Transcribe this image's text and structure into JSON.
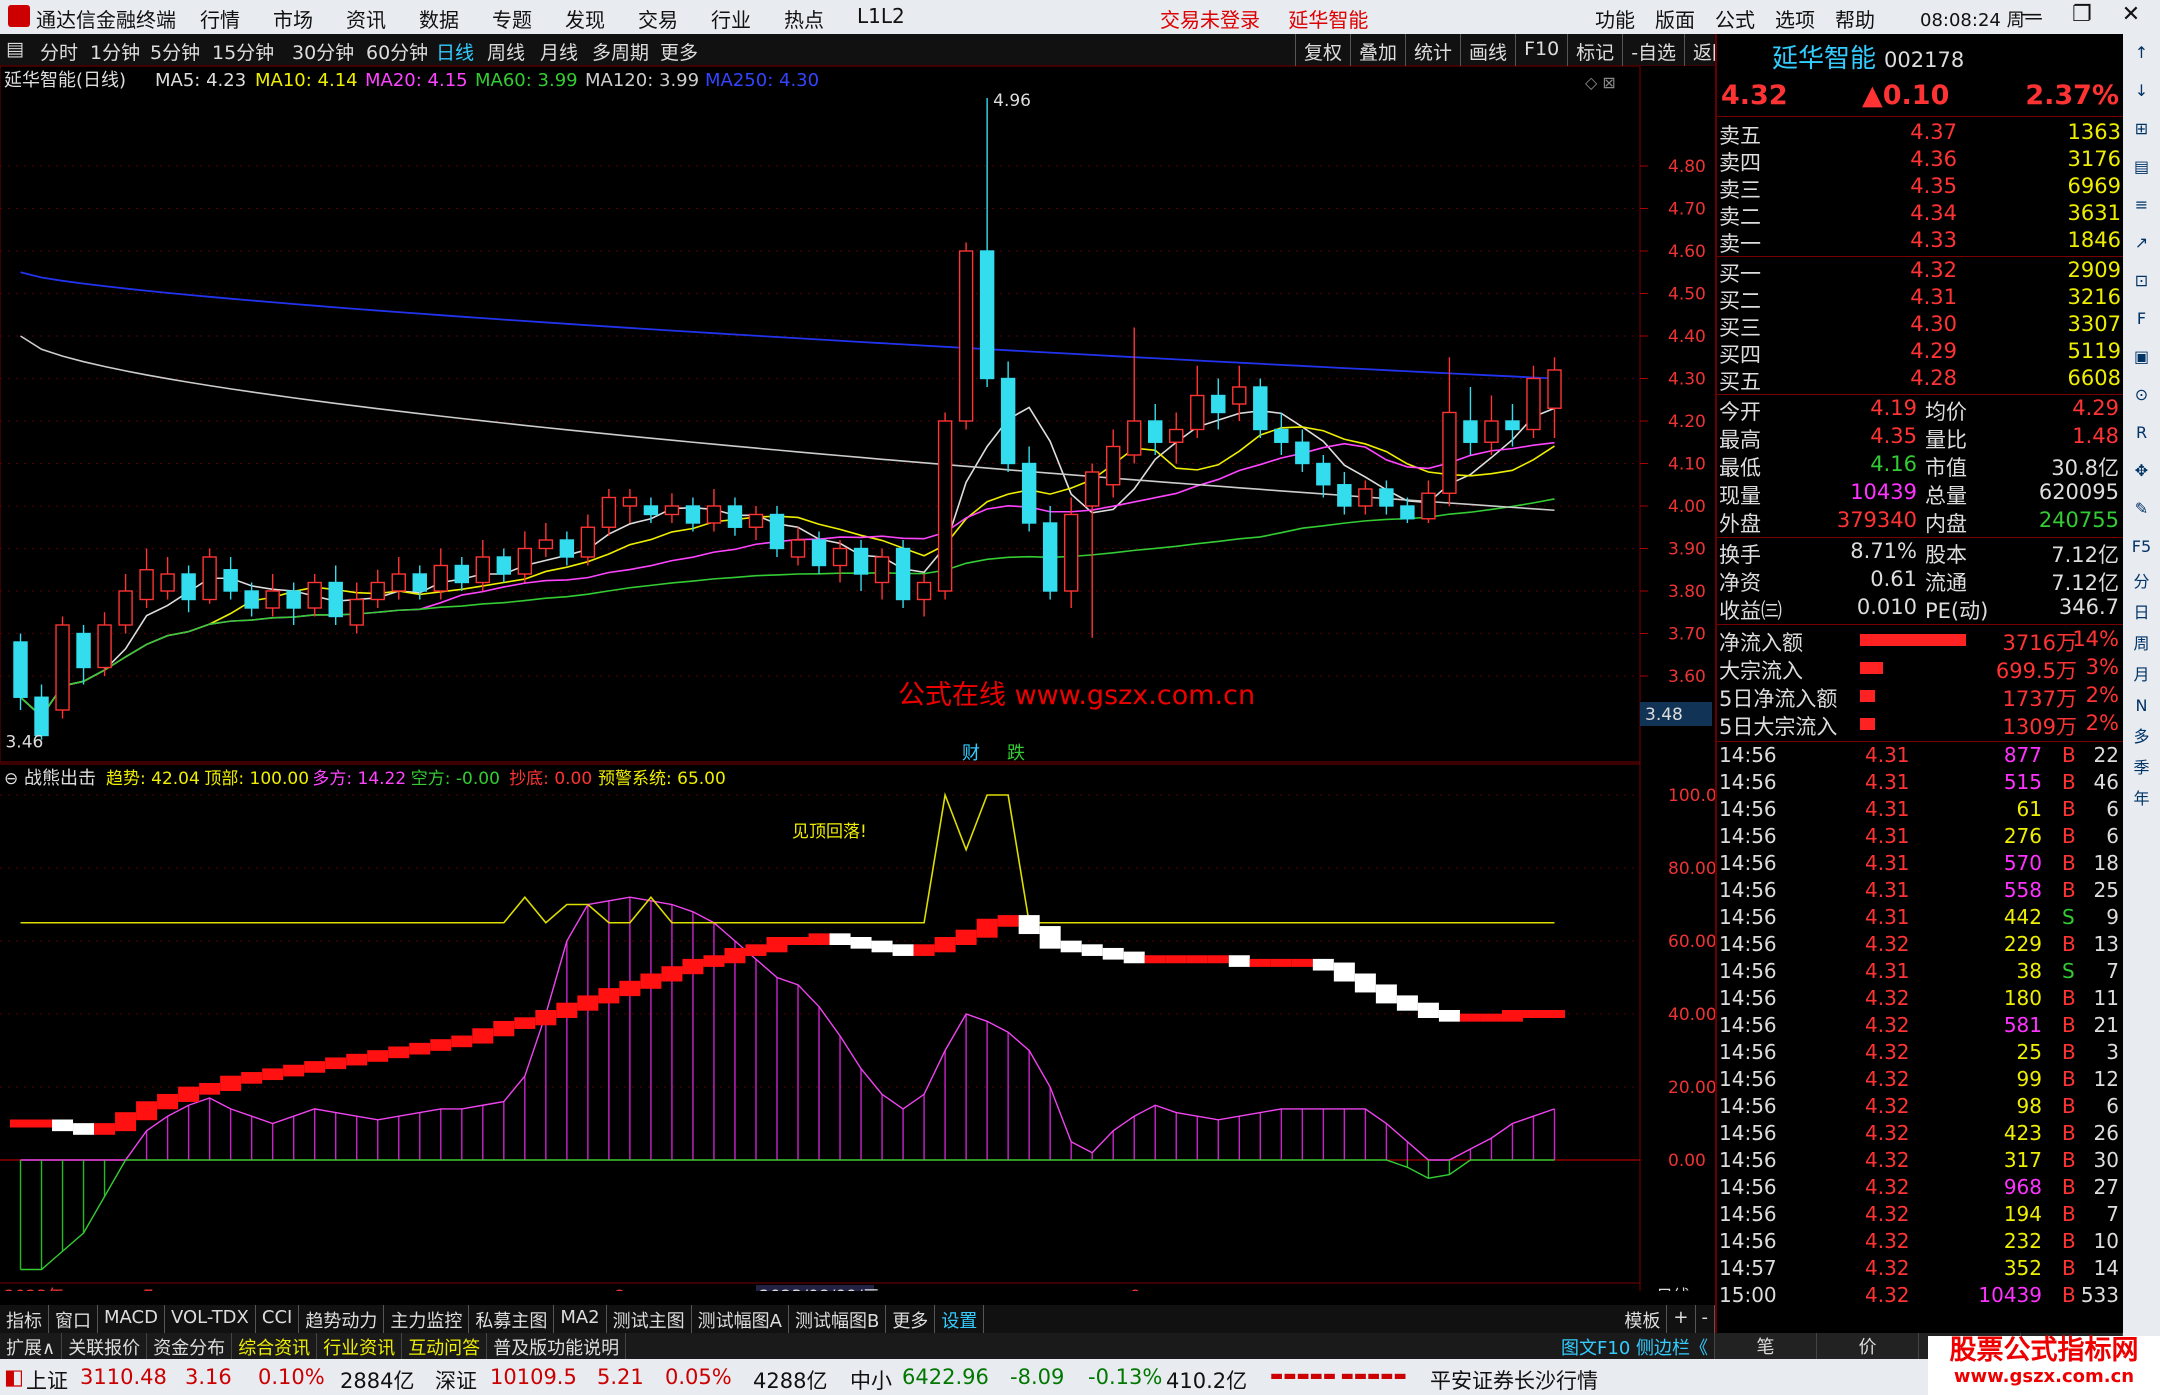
{
  "titlebar": {
    "app": "通达信金融终端",
    "menus": [
      "行情",
      "市场",
      "资讯",
      "数据",
      "专题",
      "发现",
      "交易",
      "行业",
      "热点",
      "L1L2"
    ],
    "trade_status": "交易未登录",
    "stock_name": "延华智能",
    "funcs": [
      "功能",
      "版面",
      "公式",
      "选项",
      "帮助"
    ],
    "time": "08:08:24",
    "weekday": "周一"
  },
  "periods": [
    "分时",
    "1分钟",
    "5分钟",
    "15分钟",
    "30分钟",
    "60分钟",
    "日线",
    "周线",
    "月线",
    "多周期",
    "更多"
  ],
  "active_period": "日线",
  "tools": [
    "复权",
    "叠加",
    "统计",
    "画线",
    "F10",
    "标记",
    "-自选",
    "返回"
  ],
  "main": {
    "title": "延华智能(日线)",
    "ma": [
      {
        "t": "MA5: 4.23",
        "c": "#dddddd"
      },
      {
        "t": "MA10: 4.14",
        "c": "#eeee00"
      },
      {
        "t": "MA20: 4.15",
        "c": "#ff44ff"
      },
      {
        "t": "MA60: 3.99",
        "c": "#33cc33"
      },
      {
        "t": "MA120: 3.99",
        "c": "#cccccc"
      },
      {
        "t": "MA250: 4.30",
        "c": "#3344ff"
      }
    ],
    "hi_label": "4.96",
    "lo_label": "3.46",
    "last_price": "3.48",
    "watermark": "公式在线  www.gszx.com.cn",
    "badges": [
      "财",
      "跌"
    ],
    "yticks": [
      "4.80",
      "4.70",
      "4.60",
      "4.50",
      "4.40",
      "4.30",
      "4.20",
      "4.10",
      "4.00",
      "3.90",
      "3.80",
      "3.70",
      "3.60"
    ]
  },
  "indicator": {
    "name": "战熊出击",
    "items": [
      {
        "t": "趋势: 42.04",
        "c": "#eeee00"
      },
      {
        "t": "顶部: 100.00",
        "c": "#eeee00"
      },
      {
        "t": "多方: 14.22",
        "c": "#ff44ff"
      },
      {
        "t": "空方: -0.00",
        "c": "#33cc33"
      },
      {
        "t": "抄底: 0.00",
        "c": "#ff3333"
      },
      {
        "t": "预警系统: 65.00",
        "c": "#eeee00"
      }
    ],
    "annotation": "见顶回落!",
    "yticks": [
      "100.0",
      "80.00",
      "60.00",
      "40.00",
      "20.00",
      "0.00"
    ]
  },
  "xaxis": {
    "labels": [
      "2023年",
      "7",
      "8",
      "9"
    ],
    "cursor": "2023/08/09/三",
    "period": "日线"
  },
  "chart_data": [
    {
      "type": "candlestick",
      "title": "延华智能(日线)",
      "ylim": [
        3.46,
        4.96
      ],
      "hi": 4.96,
      "lo": 3.46,
      "ma": {
        "MA5": 4.23,
        "MA10": 4.14,
        "MA20": 4.15,
        "MA60": 3.99,
        "MA120": 3.99,
        "MA250": 4.3
      },
      "candles": [
        [
          3.68,
          3.55,
          3.7,
          3.52
        ],
        [
          3.55,
          3.46,
          3.58,
          3.45
        ],
        [
          3.52,
          3.72,
          3.74,
          3.5
        ],
        [
          3.7,
          3.62,
          3.72,
          3.58
        ],
        [
          3.62,
          3.72,
          3.75,
          3.6
        ],
        [
          3.72,
          3.8,
          3.84,
          3.7
        ],
        [
          3.78,
          3.85,
          3.9,
          3.76
        ],
        [
          3.8,
          3.84,
          3.88,
          3.78
        ],
        [
          3.84,
          3.78,
          3.86,
          3.75
        ],
        [
          3.78,
          3.88,
          3.9,
          3.77
        ],
        [
          3.85,
          3.8,
          3.88,
          3.78
        ],
        [
          3.8,
          3.76,
          3.82,
          3.74
        ],
        [
          3.76,
          3.8,
          3.84,
          3.74
        ],
        [
          3.8,
          3.76,
          3.82,
          3.72
        ],
        [
          3.76,
          3.82,
          3.84,
          3.74
        ],
        [
          3.82,
          3.74,
          3.86,
          3.72
        ],
        [
          3.72,
          3.78,
          3.82,
          3.7
        ],
        [
          3.78,
          3.82,
          3.85,
          3.76
        ],
        [
          3.8,
          3.84,
          3.88,
          3.78
        ],
        [
          3.84,
          3.8,
          3.86,
          3.78
        ],
        [
          3.8,
          3.86,
          3.9,
          3.78
        ],
        [
          3.86,
          3.82,
          3.88,
          3.8
        ],
        [
          3.82,
          3.88,
          3.92,
          3.8
        ],
        [
          3.88,
          3.84,
          3.9,
          3.82
        ],
        [
          3.84,
          3.9,
          3.94,
          3.82
        ],
        [
          3.9,
          3.92,
          3.96,
          3.88
        ],
        [
          3.92,
          3.88,
          3.94,
          3.86
        ],
        [
          3.88,
          3.95,
          3.98,
          3.86
        ],
        [
          3.95,
          4.02,
          4.04,
          3.93
        ],
        [
          4.0,
          4.02,
          4.04,
          3.96
        ],
        [
          4.0,
          3.98,
          4.02,
          3.96
        ],
        [
          3.98,
          4.0,
          4.03,
          3.96
        ],
        [
          4.0,
          3.96,
          4.02,
          3.94
        ],
        [
          3.96,
          4.0,
          4.04,
          3.94
        ],
        [
          4.0,
          3.95,
          4.02,
          3.93
        ],
        [
          3.95,
          3.98,
          4.0,
          3.92
        ],
        [
          3.98,
          3.9,
          4.0,
          3.88
        ],
        [
          3.88,
          3.92,
          3.95,
          3.86
        ],
        [
          3.92,
          3.86,
          3.94,
          3.84
        ],
        [
          3.86,
          3.9,
          3.92,
          3.82
        ],
        [
          3.9,
          3.84,
          3.92,
          3.8
        ],
        [
          3.82,
          3.88,
          3.9,
          3.78
        ],
        [
          3.9,
          3.78,
          3.92,
          3.76
        ],
        [
          3.78,
          3.82,
          3.84,
          3.74
        ],
        [
          3.8,
          4.2,
          4.22,
          3.78
        ],
        [
          4.2,
          4.6,
          4.62,
          4.18
        ],
        [
          4.6,
          4.3,
          4.96,
          4.28
        ],
        [
          4.3,
          4.1,
          4.34,
          4.08
        ],
        [
          4.1,
          3.96,
          4.14,
          3.94
        ],
        [
          3.96,
          3.8,
          4.0,
          3.78
        ],
        [
          3.8,
          3.98,
          4.02,
          3.76
        ],
        [
          4.0,
          4.08,
          4.1,
          3.69
        ],
        [
          4.05,
          4.14,
          4.18,
          4.02
        ],
        [
          4.12,
          4.2,
          4.42,
          4.1
        ],
        [
          4.2,
          4.15,
          4.24,
          4.12
        ],
        [
          4.15,
          4.18,
          4.22,
          4.1
        ],
        [
          4.18,
          4.26,
          4.33,
          4.16
        ],
        [
          4.26,
          4.22,
          4.3,
          4.18
        ],
        [
          4.24,
          4.28,
          4.33,
          4.2
        ],
        [
          4.28,
          4.18,
          4.3,
          4.16
        ],
        [
          4.18,
          4.15,
          4.22,
          4.12
        ],
        [
          4.15,
          4.1,
          4.18,
          4.08
        ],
        [
          4.1,
          4.05,
          4.12,
          4.02
        ],
        [
          4.05,
          4.0,
          4.08,
          3.98
        ],
        [
          4.0,
          4.04,
          4.06,
          3.98
        ],
        [
          4.04,
          4.0,
          4.06,
          3.98
        ],
        [
          4.0,
          3.97,
          4.02,
          3.96
        ],
        [
          3.97,
          4.03,
          4.06,
          3.96
        ],
        [
          4.03,
          4.22,
          4.35,
          4.0
        ],
        [
          4.2,
          4.15,
          4.28,
          4.12
        ],
        [
          4.15,
          4.2,
          4.26,
          4.12
        ],
        [
          4.2,
          4.18,
          4.24,
          4.14
        ],
        [
          4.18,
          4.3,
          4.33,
          4.16
        ],
        [
          4.23,
          4.32,
          4.35,
          4.16
        ]
      ]
    },
    {
      "type": "line",
      "title": "战熊出击",
      "ylim": [
        0,
        100
      ],
      "series": [
        {
          "name": "顶部",
          "values": [
            65,
            65,
            65,
            65,
            65,
            65,
            65,
            65,
            65,
            65,
            65,
            65,
            65,
            65,
            65,
            65,
            65,
            65,
            65,
            65,
            65,
            65,
            65,
            65,
            72,
            65,
            70,
            70,
            65,
            65,
            72,
            65,
            65,
            65,
            65,
            65,
            65,
            65,
            65,
            65,
            65,
            65,
            65,
            65,
            100,
            85,
            100,
            100,
            65,
            65,
            65,
            65,
            65,
            65,
            65,
            65,
            65,
            65,
            65,
            65,
            65,
            65,
            65,
            65,
            65,
            65,
            65,
            65,
            65,
            65,
            65,
            65,
            65,
            65
          ]
        },
        {
          "name": "趋势",
          "values": [
            10,
            10,
            9,
            8,
            9,
            12,
            15,
            17,
            19,
            20,
            22,
            23,
            24,
            25,
            26,
            27,
            28,
            29,
            30,
            31,
            32,
            33,
            35,
            37,
            38,
            40,
            42,
            44,
            46,
            48,
            50,
            52,
            54,
            55,
            57,
            58,
            60,
            60,
            61,
            60,
            59,
            58,
            57,
            58,
            60,
            62,
            65,
            66,
            63,
            59,
            58,
            57,
            56,
            55,
            55,
            55,
            55,
            55,
            54,
            54,
            54,
            54,
            53,
            50,
            47,
            44,
            42,
            40,
            39,
            39,
            39,
            40,
            40,
            40
          ]
        },
        {
          "name": "多方",
          "values": [
            0,
            0,
            0,
            0,
            0,
            0,
            8,
            12,
            15,
            17,
            14,
            12,
            10,
            12,
            14,
            13,
            12,
            11,
            12,
            13,
            14,
            14,
            15,
            16,
            23,
            40,
            60,
            70,
            71,
            72,
            71,
            70,
            68,
            65,
            60,
            55,
            50,
            48,
            42,
            34,
            25,
            18,
            14,
            18,
            30,
            40,
            38,
            35,
            30,
            20,
            5,
            2,
            8,
            12,
            15,
            13,
            12,
            11,
            12,
            13,
            14,
            14,
            14,
            14,
            14,
            10,
            5,
            0,
            0,
            3,
            6,
            10,
            12,
            14
          ]
        },
        {
          "name": "空方",
          "values": [
            -30,
            -30,
            -25,
            -20,
            -10,
            0,
            0,
            0,
            0,
            0,
            0,
            0,
            0,
            0,
            0,
            0,
            0,
            0,
            0,
            0,
            0,
            0,
            0,
            0,
            0,
            0,
            0,
            0,
            0,
            0,
            0,
            0,
            0,
            0,
            0,
            0,
            0,
            0,
            0,
            0,
            0,
            0,
            0,
            0,
            0,
            0,
            0,
            0,
            0,
            0,
            0,
            0,
            0,
            0,
            0,
            0,
            0,
            0,
            0,
            0,
            0,
            0,
            0,
            0,
            0,
            0,
            -2,
            -5,
            -4,
            0,
            0,
            0,
            0,
            0
          ]
        }
      ]
    }
  ],
  "right": {
    "name": "延华智能",
    "code": "002178",
    "price": "4.32",
    "change": "▲0.10",
    "pct": "2.37%",
    "asks": [
      [
        "卖五",
        "4.37",
        "1363"
      ],
      [
        "卖四",
        "4.36",
        "3176"
      ],
      [
        "卖三",
        "4.35",
        "6969"
      ],
      [
        "卖二",
        "4.34",
        "3631"
      ],
      [
        "卖一",
        "4.33",
        "1846"
      ]
    ],
    "bids": [
      [
        "买一",
        "4.32",
        "2909"
      ],
      [
        "买二",
        "4.31",
        "3216"
      ],
      [
        "买三",
        "4.30",
        "3307"
      ],
      [
        "买四",
        "4.29",
        "5119"
      ],
      [
        "买五",
        "4.28",
        "6608"
      ]
    ],
    "stats": [
      [
        "今开",
        "4.19",
        "均价",
        "4.29"
      ],
      [
        "最高",
        "4.35",
        "量比",
        "1.48"
      ],
      [
        "最低",
        "4.16",
        "市值",
        "30.8亿"
      ],
      [
        "现量",
        "10439",
        "总量",
        "620095"
      ],
      [
        "外盘",
        "379340",
        "内盘",
        "240755"
      ]
    ],
    "stats2": [
      [
        "换手",
        "8.71%",
        "股本",
        "7.12亿"
      ],
      [
        "净资",
        "0.61",
        "流通",
        "7.12亿"
      ],
      [
        "收益㈢",
        "0.010",
        "PE(动)",
        "346.7"
      ]
    ],
    "flows": [
      [
        "净流入额",
        "3716万",
        "14%"
      ],
      [
        "大宗流入",
        "699.5万",
        "3%"
      ],
      [
        "5日净流入额",
        "1737万",
        "2%"
      ],
      [
        "5日大宗流入",
        "1309万",
        "2%"
      ]
    ],
    "flows_pct": [
      14,
      3,
      2,
      2
    ],
    "ticks": [
      [
        "14:56",
        "4.31",
        "877",
        "B",
        "22"
      ],
      [
        "14:56",
        "4.31",
        "515",
        "B",
        "46"
      ],
      [
        "14:56",
        "4.31",
        "61",
        "B",
        "6"
      ],
      [
        "14:56",
        "4.31",
        "276",
        "B",
        "6"
      ],
      [
        "14:56",
        "4.31",
        "570",
        "B",
        "18"
      ],
      [
        "14:56",
        "4.31",
        "558",
        "B",
        "25"
      ],
      [
        "14:56",
        "4.31",
        "442",
        "S",
        "9"
      ],
      [
        "14:56",
        "4.32",
        "229",
        "B",
        "13"
      ],
      [
        "14:56",
        "4.31",
        "38",
        "S",
        "7"
      ],
      [
        "14:56",
        "4.32",
        "180",
        "B",
        "11"
      ],
      [
        "14:56",
        "4.32",
        "581",
        "B",
        "21"
      ],
      [
        "14:56",
        "4.32",
        "25",
        "B",
        "3"
      ],
      [
        "14:56",
        "4.32",
        "99",
        "B",
        "12"
      ],
      [
        "14:56",
        "4.32",
        "98",
        "B",
        "6"
      ],
      [
        "14:56",
        "4.32",
        "423",
        "B",
        "26"
      ],
      [
        "14:56",
        "4.32",
        "317",
        "B",
        "30"
      ],
      [
        "14:56",
        "4.32",
        "968",
        "B",
        "27"
      ],
      [
        "14:56",
        "4.32",
        "194",
        "B",
        "7"
      ],
      [
        "14:56",
        "4.32",
        "232",
        "B",
        "10"
      ],
      [
        "14:57",
        "4.32",
        "352",
        "B",
        "14"
      ],
      [
        "15:00",
        "4.32",
        "10439",
        "B",
        "533"
      ]
    ],
    "tabs": [
      "笔",
      "价",
      "细",
      "势"
    ]
  },
  "sidebar": [
    "分",
    "日",
    "周",
    "月",
    "N",
    "多",
    "季",
    "年"
  ],
  "bottom_tabs": [
    "指标",
    "窗口",
    "MACD",
    "VOL-TDX",
    "CCI",
    "趋势动力",
    "主力监控",
    "私募主图",
    "MA2",
    "测试主图",
    "测试幅图A",
    "测试幅图B",
    "更多",
    "设置"
  ],
  "bottom_active": "设置",
  "bottom_right": [
    "模板",
    "+",
    "-"
  ],
  "links": [
    "扩展∧",
    "关联报价",
    "资金分布",
    "综合资讯",
    "行业资讯",
    "互动问答",
    "普及版功能说明"
  ],
  "f10": "图文F10 侧边栏《",
  "status": {
    "sh": "上证",
    "sh_v": "3110.48",
    "sh_c": "3.16",
    "sh_p": "0.10%",
    "sh_a": "2884亿",
    "sz": "深证",
    "sz_v": "10109.5",
    "sz_c": "5.21",
    "sz_p": "0.05%",
    "sz_a": "4288亿",
    "zx": "中小",
    "zx_v": "6422.96",
    "zx_c": "-8.09",
    "zx_p": "-0.13%",
    "zx_a": "410.2亿",
    "broker": "平安证券长沙行情"
  },
  "ad": {
    "title": "股票公式指标网",
    "url": "www.gszx.com.cn"
  }
}
